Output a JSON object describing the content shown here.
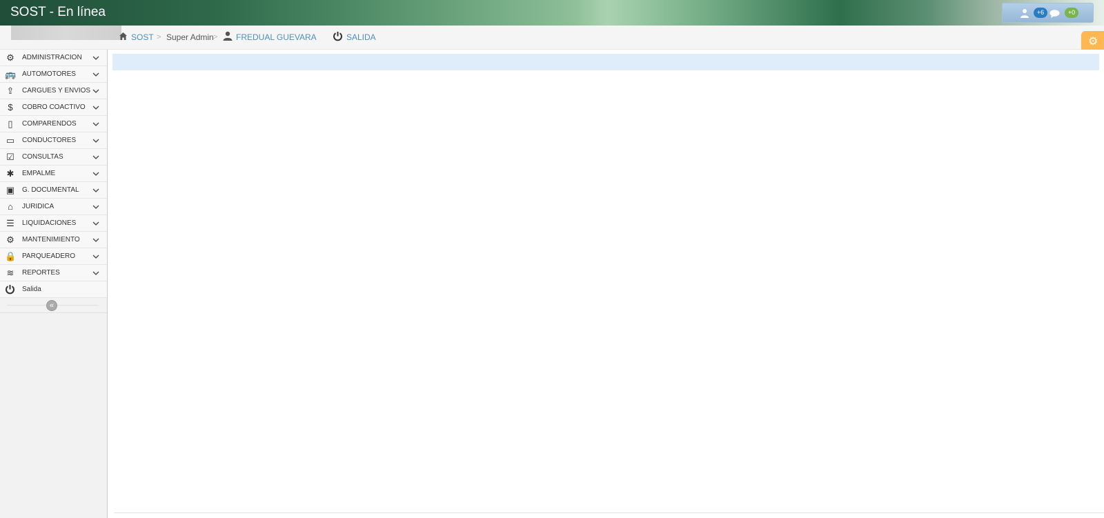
{
  "navbar": {
    "brand": "SOST - En línea",
    "user_icon": "user-icon",
    "badge_alerts": "+6",
    "chat_icon": "comment-icon",
    "badge_messages": "+0"
  },
  "breadcrumbs": {
    "home_icon": "home-icon",
    "home_label": "SOST",
    "role_label": "Super Admin",
    "user_icon": "user-icon",
    "user_label": "FREDUAL GUEVARA",
    "logout_icon": "power-icon",
    "logout_label": "SALIDA"
  },
  "settings": {
    "icon": "cog-icon"
  },
  "sidebar": {
    "items": [
      {
        "label": "ADMINISTRACION",
        "icon": "cogs-icon",
        "glyph": "⚙"
      },
      {
        "label": "AUTOMOTORES",
        "icon": "bus-icon",
        "glyph": "🚌"
      },
      {
        "label": "CARGUES Y ENVIOS",
        "icon": "upload-icon",
        "glyph": "⇪"
      },
      {
        "label": "COBRO COACTIVO",
        "icon": "dollar-icon",
        "glyph": "$"
      },
      {
        "label": "COMPARENDOS",
        "icon": "tablet-icon",
        "glyph": "▯"
      },
      {
        "label": "CONDUCTORES",
        "icon": "credit-card-icon",
        "glyph": "▭"
      },
      {
        "label": "CONSULTAS",
        "icon": "check-square-icon",
        "glyph": "☑"
      },
      {
        "label": "EMPALME",
        "icon": "bug-icon",
        "glyph": "✱"
      },
      {
        "label": "G. DOCUMENTAL",
        "icon": "archive-icon",
        "glyph": "▣"
      },
      {
        "label": "JURIDICA",
        "icon": "bank-icon",
        "glyph": "⌂"
      },
      {
        "label": "LIQUIDACIONES",
        "icon": "list-icon",
        "glyph": "☰"
      },
      {
        "label": "MANTENIMIENTO",
        "icon": "cog-icon",
        "glyph": "⚙"
      },
      {
        "label": "PARQUEADERO",
        "icon": "lock-icon",
        "glyph": "🔒"
      },
      {
        "label": "REPORTES",
        "icon": "database-icon",
        "glyph": "≋"
      }
    ],
    "exit_label": "Salida",
    "exit_icon": "power-icon",
    "collapse_icon": "double-angle-left-icon"
  },
  "colors": {
    "link": "#4c8fbd",
    "alert_bg": "#dfecfa",
    "settings_bg": "#ffb752"
  }
}
